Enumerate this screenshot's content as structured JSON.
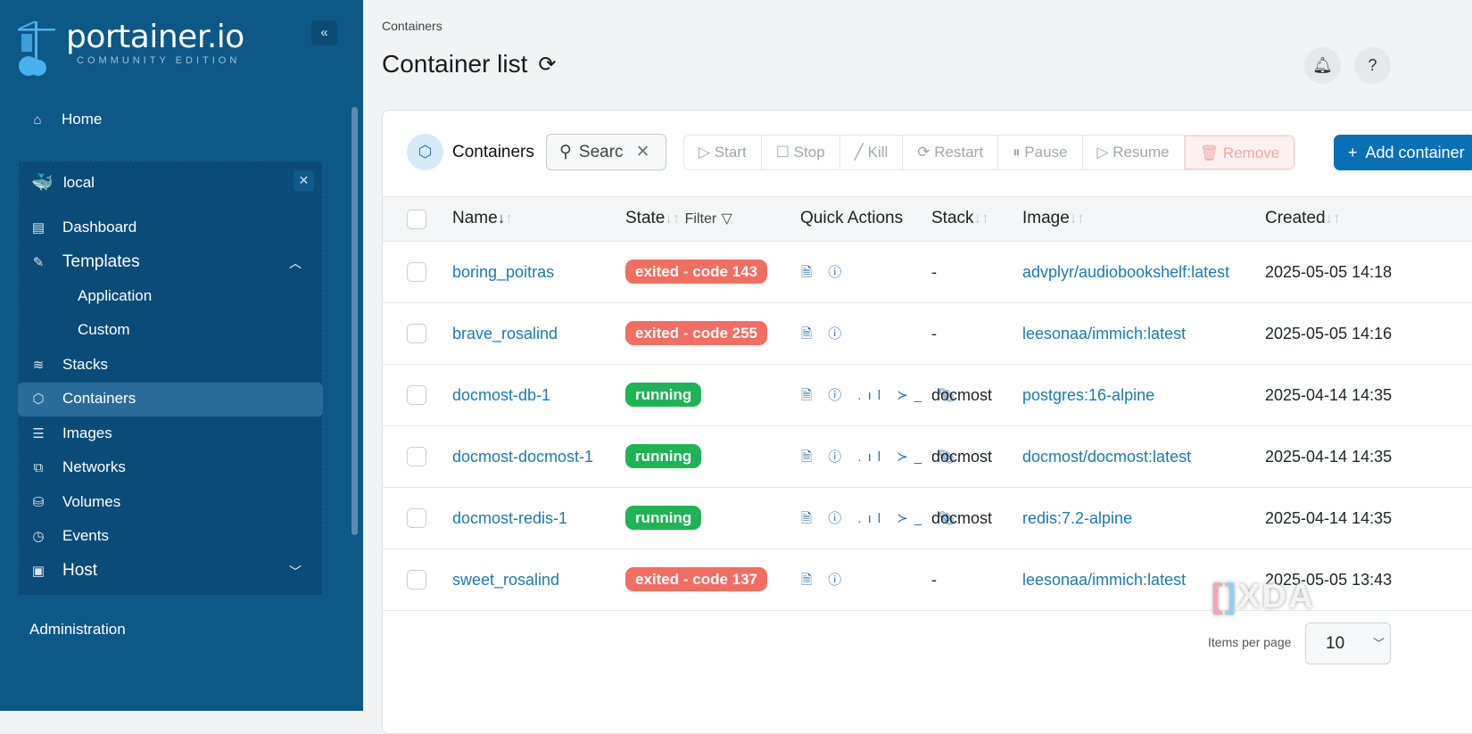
{
  "sidebar": {
    "logo": "portainer.io",
    "edition": "COMMUNITY EDITION",
    "home": "Home",
    "env_name": "local",
    "items": [
      {
        "label": "Dashboard"
      },
      {
        "label": "Templates"
      },
      {
        "label": "Application"
      },
      {
        "label": "Custom"
      },
      {
        "label": "Stacks"
      },
      {
        "label": "Containers"
      },
      {
        "label": "Images"
      },
      {
        "label": "Networks"
      },
      {
        "label": "Volumes"
      },
      {
        "label": "Events"
      },
      {
        "label": "Host"
      }
    ],
    "administration": "Administration"
  },
  "header": {
    "breadcrumb": "Containers",
    "title": "Container list"
  },
  "toolbar": {
    "title": "Containers",
    "search_placeholder": "Search",
    "search_value": "Searc",
    "start": "Start",
    "stop": "Stop",
    "kill": "Kill",
    "restart": "Restart",
    "pause": "Pause",
    "resume": "Resume",
    "remove": "Remove",
    "add": "Add container"
  },
  "table": {
    "headers": {
      "name": "Name",
      "state": "State",
      "filter": "Filter",
      "quick": "Quick Actions",
      "stack": "Stack",
      "image": "Image",
      "created": "Created"
    },
    "rows": [
      {
        "name": "boring_poitras",
        "state": "exited - code 143",
        "status": "exited",
        "stack": "-",
        "image": "advplyr/audiobookshelf:latest",
        "created": "2025-05-05 14:18"
      },
      {
        "name": "brave_rosalind",
        "state": "exited - code 255",
        "status": "exited",
        "stack": "-",
        "image": "leesonaa/immich:latest",
        "created": "2025-05-05 14:16"
      },
      {
        "name": "docmost-db-1",
        "state": "running",
        "status": "running",
        "stack": "docmost",
        "image": "postgres:16-alpine",
        "created": "2025-04-14 14:35"
      },
      {
        "name": "docmost-docmost-1",
        "state": "running",
        "status": "running",
        "stack": "docmost",
        "image": "docmost/docmost:latest",
        "created": "2025-04-14 14:35"
      },
      {
        "name": "docmost-redis-1",
        "state": "running",
        "status": "running",
        "stack": "docmost",
        "image": "redis:7.2-alpine",
        "created": "2025-04-14 14:35"
      },
      {
        "name": "sweet_rosalind",
        "state": "exited - code 137",
        "status": "exited",
        "stack": "-",
        "image": "leesonaa/immich:latest",
        "created": "2025-05-05 13:43"
      }
    ]
  },
  "pagination": {
    "label": "Items per page",
    "value": "10"
  },
  "colors": {
    "exited": "#f26e62",
    "running": "#1fb356",
    "sidebar": "#0d5887",
    "accent": "#0b6fb6"
  },
  "watermark": "XDA"
}
